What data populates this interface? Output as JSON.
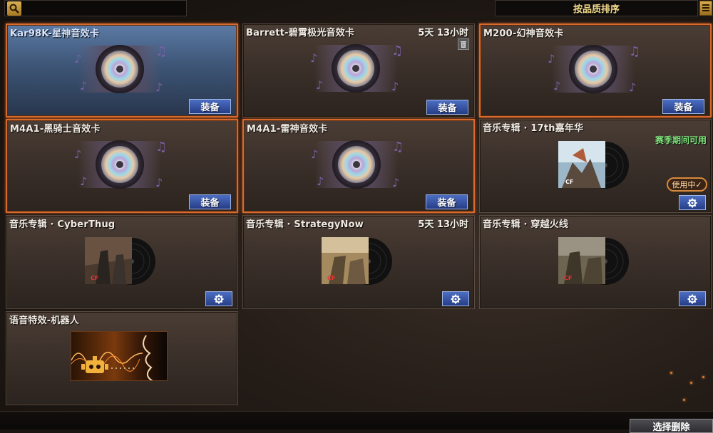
{
  "search": {
    "placeholder": ""
  },
  "sort": {
    "label": "按品质排序"
  },
  "cards": [
    {
      "title": "Kar98K-星神音效卡",
      "action": "装备"
    },
    {
      "title": "Barrett-碧霄极光音效卡",
      "timer": "5天 13小时",
      "action": "装备"
    },
    {
      "title": "M200-幻神音效卡",
      "action": "装备"
    },
    {
      "title": "M4A1-黑骑士音效卡",
      "action": "装备"
    },
    {
      "title": "M4A1-雷神音效卡",
      "action": "装备"
    },
    {
      "title": "音乐专辑 · 17th嘉年华",
      "season": "赛季期间可用",
      "status": "使用中✓"
    },
    {
      "title": "音乐专辑 · CyberThug"
    },
    {
      "title": "音乐专辑 · StrategyNow",
      "timer": "5天 13小时"
    },
    {
      "title": "音乐专辑 · 穿越火线"
    },
    {
      "title": "语音特效-机器人"
    }
  ],
  "footer": {
    "select_delete": "选择删除"
  },
  "icons": {
    "search": "search-icon",
    "menu": "menu-icon",
    "trash": "trash-icon",
    "gear": "gear-icon",
    "disc": "disc-icon",
    "robot": "robot-icon"
  },
  "colors": {
    "selected_border": "#d76a2c",
    "button_blue": "#3a56a4",
    "season_green": "#7ee07a",
    "gold": "#f2d98a"
  }
}
